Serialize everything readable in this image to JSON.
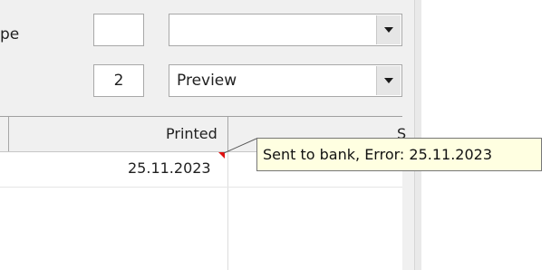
{
  "form": {
    "type_label_partial": "pe",
    "row1": {
      "small_value": "",
      "combo_value": ""
    },
    "row2": {
      "small_value": "2",
      "combo_value": "Preview"
    }
  },
  "grid": {
    "columns": [
      {
        "label": "Printed"
      },
      {
        "label": "S"
      }
    ],
    "rows": [
      {
        "printed": "25.11.2023"
      }
    ]
  },
  "tooltip": {
    "text": "Sent to bank, Error: 25.11.2023"
  },
  "colors": {
    "tooltip_bg": "#ffffe1",
    "comment_marker": "#e01010"
  }
}
